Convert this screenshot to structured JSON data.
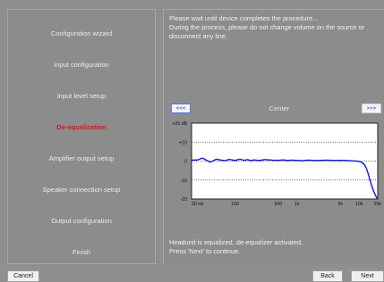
{
  "steps": [
    {
      "label": "Configuration wizard",
      "active": false
    },
    {
      "label": "Input configuration",
      "active": false
    },
    {
      "label": "Input level setup",
      "active": false
    },
    {
      "label": "De-equalization",
      "active": true
    },
    {
      "label": "Amplifier output setup",
      "active": false
    },
    {
      "label": "Speaker connection setup",
      "active": false
    },
    {
      "label": "Output configuration",
      "active": false
    },
    {
      "label": "Finish",
      "active": false
    }
  ],
  "messages": {
    "top": [
      "Please wait until device completes the procedure...",
      "During the process, please do not change volume on the source or",
      "disconnect any line."
    ],
    "bottom": [
      "Headunit is equalized, de-equalizer activated.",
      "Press 'Next' to continue."
    ]
  },
  "band_nav": {
    "prev_label": "<<<",
    "next_label": ">>>",
    "band": "Center"
  },
  "chart_data": {
    "type": "line",
    "y_ticks": [
      "+20 dB",
      "+10",
      "0",
      "-10",
      "-20"
    ],
    "x_ticks": [
      "20 Hz",
      "100",
      "500",
      "1k",
      "5k",
      "10k",
      "20k"
    ],
    "ylim": [
      -20,
      20
    ],
    "xlim_hz": [
      20,
      20000
    ],
    "grid": "dotted horizontal",
    "series": [
      {
        "color": "#1515e6",
        "x": [
          20,
          25,
          30,
          35,
          40,
          45,
          50,
          60,
          70,
          80,
          90,
          100,
          120,
          140,
          160,
          180,
          200,
          250,
          300,
          400,
          500,
          600,
          700,
          800,
          1000,
          1200,
          1500,
          2000,
          2500,
          3000,
          4000,
          5000,
          6000,
          7000,
          8000,
          9000,
          10000,
          11000,
          12000,
          13000,
          14000,
          15000,
          16000,
          17000,
          18000,
          19000,
          20000
        ],
        "y": [
          0.5,
          0.6,
          1.6,
          0.4,
          -0.6,
          0.2,
          1.0,
          0.5,
          0.2,
          0.9,
          0.6,
          0.3,
          1.0,
          0.4,
          0.8,
          0.2,
          0.6,
          0.3,
          0.8,
          0.5,
          0.4,
          0.6,
          0.3,
          0.5,
          0.4,
          0.2,
          0.5,
          0.3,
          0.4,
          0.5,
          0.3,
          0.4,
          0.3,
          0.2,
          0.1,
          0.0,
          -0.2,
          -0.6,
          -1.6,
          -3.5,
          -6.5,
          -10.0,
          -13.0,
          -15.5,
          -17.5,
          -19.0,
          -20.0
        ]
      }
    ]
  },
  "buttons": {
    "cancel": "Cancel",
    "back": "Back",
    "next": "Next"
  }
}
